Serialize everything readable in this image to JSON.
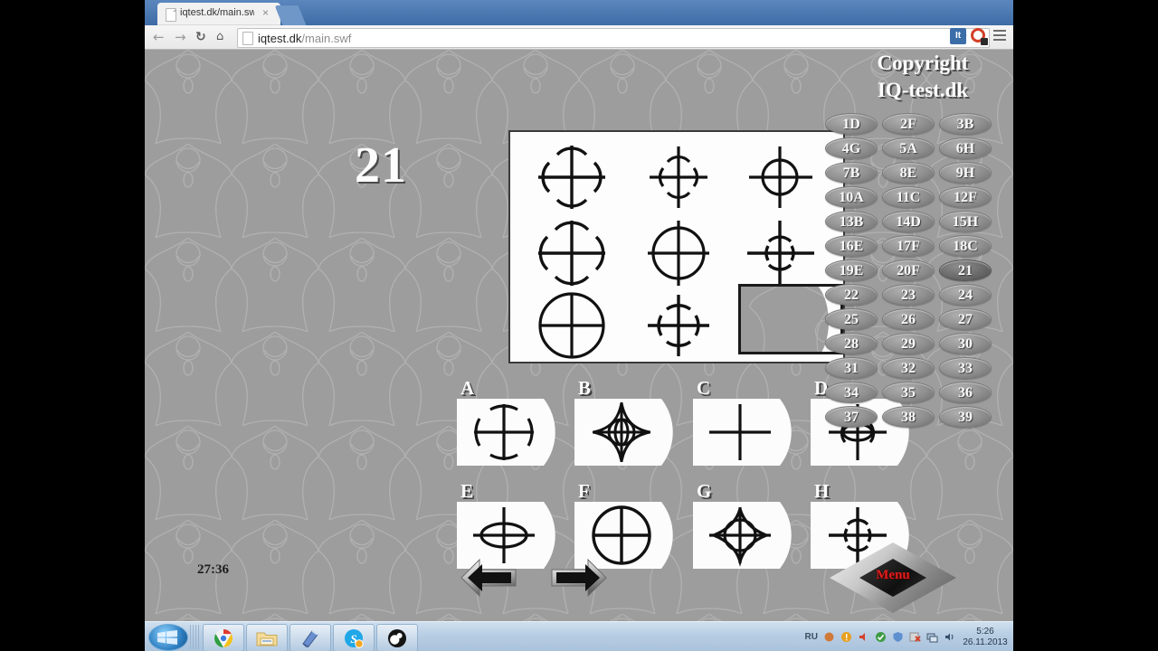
{
  "browser": {
    "tab": {
      "title": "iqtest.dk/main.swf",
      "close_label": "×",
      "favicon": "page-icon"
    },
    "nav": {
      "back": "←",
      "forward": "→",
      "reload": "↻",
      "home": "⌂"
    },
    "omnibox": {
      "domain": "iqtest.dk",
      "path": "/main.swf",
      "full": "iqtest.dk/main.swf"
    },
    "actions": {
      "bookmark": "☆",
      "extension_badge": "It",
      "menu": "hamburger-menu"
    }
  },
  "stage": {
    "question_number": "21",
    "timer": "27:36",
    "copyright_line1": "Copyright",
    "copyright_line2": "IQ-test.dk",
    "menu_label": "Menu",
    "nav_prev": "previous-arrow",
    "nav_next": "next-arrow"
  },
  "matrix": {
    "rows": [
      [
        "cross-large-4arcs",
        "cross-medium-4arcs",
        "cross-small-circle"
      ],
      [
        "cross-large-arcs-wide",
        "cross-medium-circle",
        "cross-small-4arcs"
      ],
      [
        "circle-large-cross",
        "cross-medium-dashed-circle",
        "missing"
      ]
    ]
  },
  "options": [
    {
      "label": "A",
      "shape": "large-dashed-circle-cross"
    },
    {
      "label": "B",
      "shape": "star-diamond-circle-cross"
    },
    {
      "label": "C",
      "shape": "plain-cross"
    },
    {
      "label": "D",
      "shape": "small-ellipse-arcs-cross"
    },
    {
      "label": "E",
      "shape": "flat-ellipse-cross"
    },
    {
      "label": "F",
      "shape": "big-circle-cross"
    },
    {
      "label": "G",
      "shape": "four-point-star-circle-cross"
    },
    {
      "label": "H",
      "shape": "small-dashed-circle-cross"
    }
  ],
  "answer_list": {
    "rows": [
      [
        "1D",
        "2F",
        "3B"
      ],
      [
        "4G",
        "5A",
        "6H"
      ],
      [
        "7B",
        "8E",
        "9H"
      ],
      [
        "10A",
        "11C",
        "12F"
      ],
      [
        "13B",
        "14D",
        "15H"
      ],
      [
        "16E",
        "17F",
        "18C"
      ],
      [
        "19E",
        "20F",
        "21"
      ],
      [
        "22",
        "23",
        "24"
      ],
      [
        "25",
        "26",
        "27"
      ],
      [
        "28",
        "29",
        "30"
      ],
      [
        "31",
        "32",
        "33"
      ],
      [
        "34",
        "35",
        "36"
      ],
      [
        "37",
        "38",
        "39"
      ]
    ],
    "active": "21"
  },
  "taskbar": {
    "start": "windows-start-orb",
    "items": [
      "chrome-icon",
      "explorer-icon",
      "notepad-icon",
      "skype-icon",
      "obs-icon"
    ],
    "tray": {
      "language": "RU",
      "time": "5:26",
      "date": "26.11.2013"
    }
  },
  "colors": {
    "stage_bg": "#9d9d9d",
    "panel_white": "#fcfcfc",
    "stroke": "#111111",
    "menu_red": "#e01b1b",
    "tab_blue": "#3f6ca6"
  }
}
